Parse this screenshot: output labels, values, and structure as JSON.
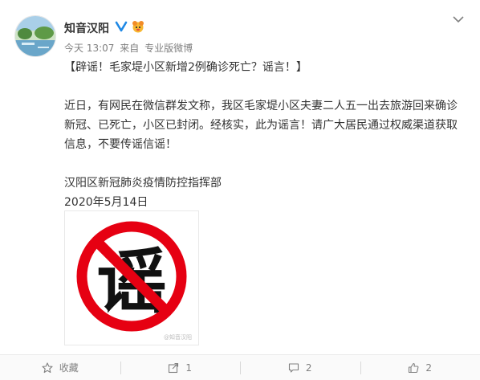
{
  "post": {
    "user_name": "知音汉阳",
    "time": "今天 13:07",
    "source_prefix": "来自",
    "source": "专业版微博",
    "headline": "【辟谣！毛家堤小区新增2例确诊死亡？谣言！】",
    "body_lines": [
      "近日，有网民在微信群发文称，我区毛家堤小区夫妻二人五一出去旅游回来确诊",
      "新冠、已死亡，小区已封闭。经核实，此为谣言！请广大居民通过权威渠道获取",
      "信息，不要传谣信谣！"
    ],
    "signature": "汉阳区新冠肺炎疫情防控指挥部",
    "date": "2020年5月14日",
    "image": {
      "character": "谣",
      "watermark": "@知音汉阳"
    }
  },
  "actions": {
    "favorite_label": "收藏",
    "repost_count": "1",
    "comment_count": "2",
    "like_count": "2"
  },
  "colors": {
    "ban_red": "#e60012",
    "link_orange": "#eb7350",
    "verified_blue": "#1e88e5"
  },
  "icons": [
    "verified-icon",
    "vip-icon",
    "chevron-down-icon",
    "star-icon",
    "share-icon",
    "comment-icon",
    "thumbs-up-icon"
  ]
}
